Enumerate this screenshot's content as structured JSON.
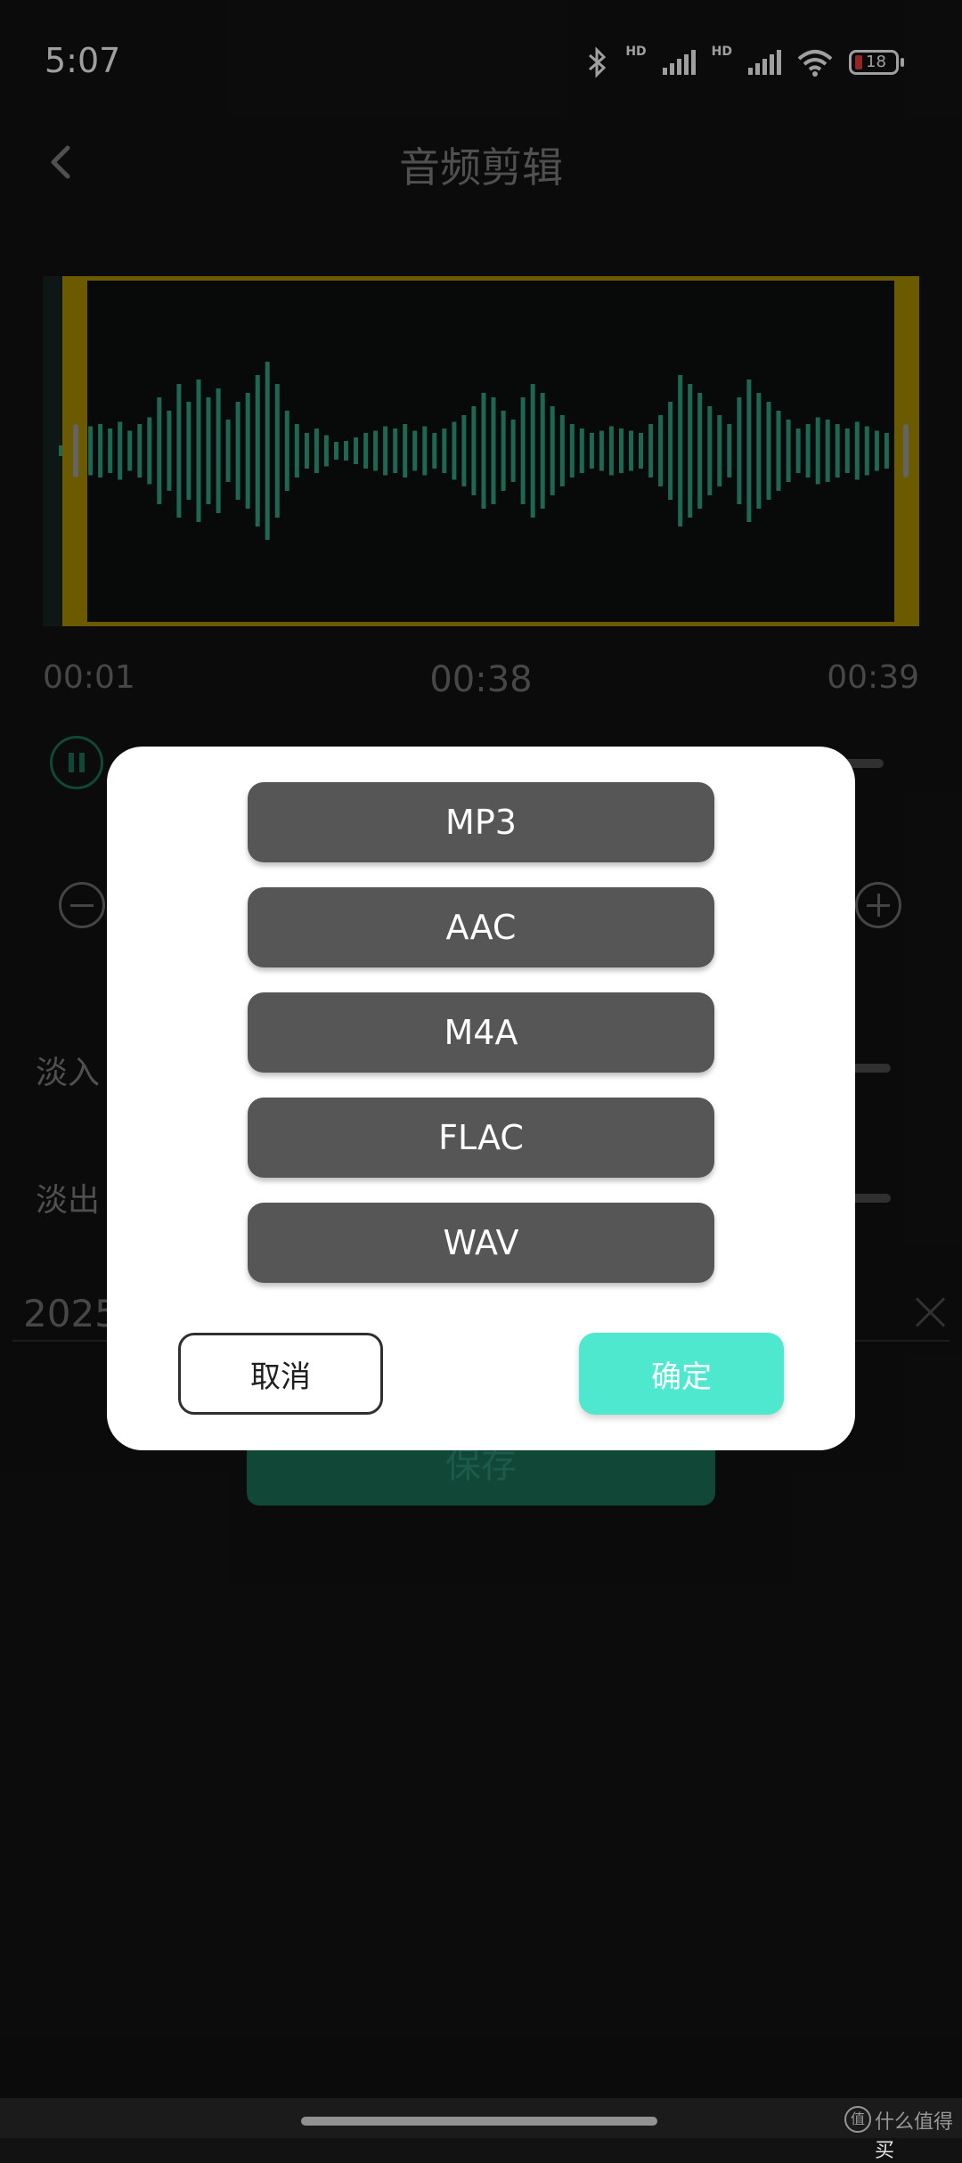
{
  "status_bar": {
    "time": "5:07",
    "hd_1": "HD",
    "hd_2": "HD",
    "battery_level": "18",
    "icons": [
      "bluetooth-icon",
      "signal-icon",
      "signal-icon",
      "wifi-icon",
      "battery-icon"
    ]
  },
  "header": {
    "title": "音频剪辑",
    "back_icon": "chevron-left-icon"
  },
  "timeline": {
    "start": "00:01",
    "current": "00:38",
    "end": "00:39"
  },
  "controls": {
    "fade_in_label": "淡入",
    "fade_out_label": "淡出",
    "filename_prefix": "2025",
    "save_label": "保存"
  },
  "dialog": {
    "formats": [
      "MP3",
      "AAC",
      "M4A",
      "FLAC",
      "WAV"
    ],
    "cancel_label": "取消",
    "confirm_label": "确定"
  },
  "watermark": {
    "badge": "值",
    "text": "什么值得买"
  },
  "colors": {
    "accent": "#4ee8cf",
    "wave": "#2f9e7f",
    "selection": "#a58a00",
    "save": "#1b6d54",
    "format_button": "#565656"
  }
}
